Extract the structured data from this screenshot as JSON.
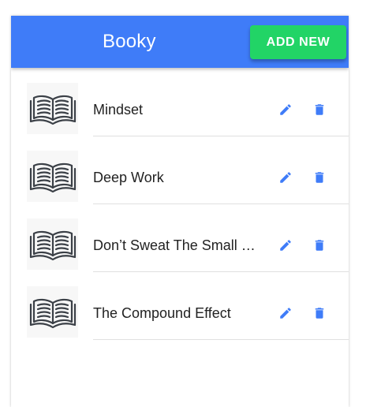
{
  "app": {
    "title": "Booky",
    "add_button_label": "ADD NEW"
  },
  "colors": {
    "primary": "#3f7cf8",
    "add_button": "#22d466",
    "action_icon": "#3f7cf8"
  },
  "icons": {
    "thumbnail": "open-book-icon",
    "edit": "pencil-icon",
    "delete": "trash-icon"
  },
  "books": [
    {
      "title": "Mindset"
    },
    {
      "title": "Deep Work"
    },
    {
      "title": "Don’t Sweat The Small Stuff"
    },
    {
      "title": "The Compound Effect"
    }
  ]
}
